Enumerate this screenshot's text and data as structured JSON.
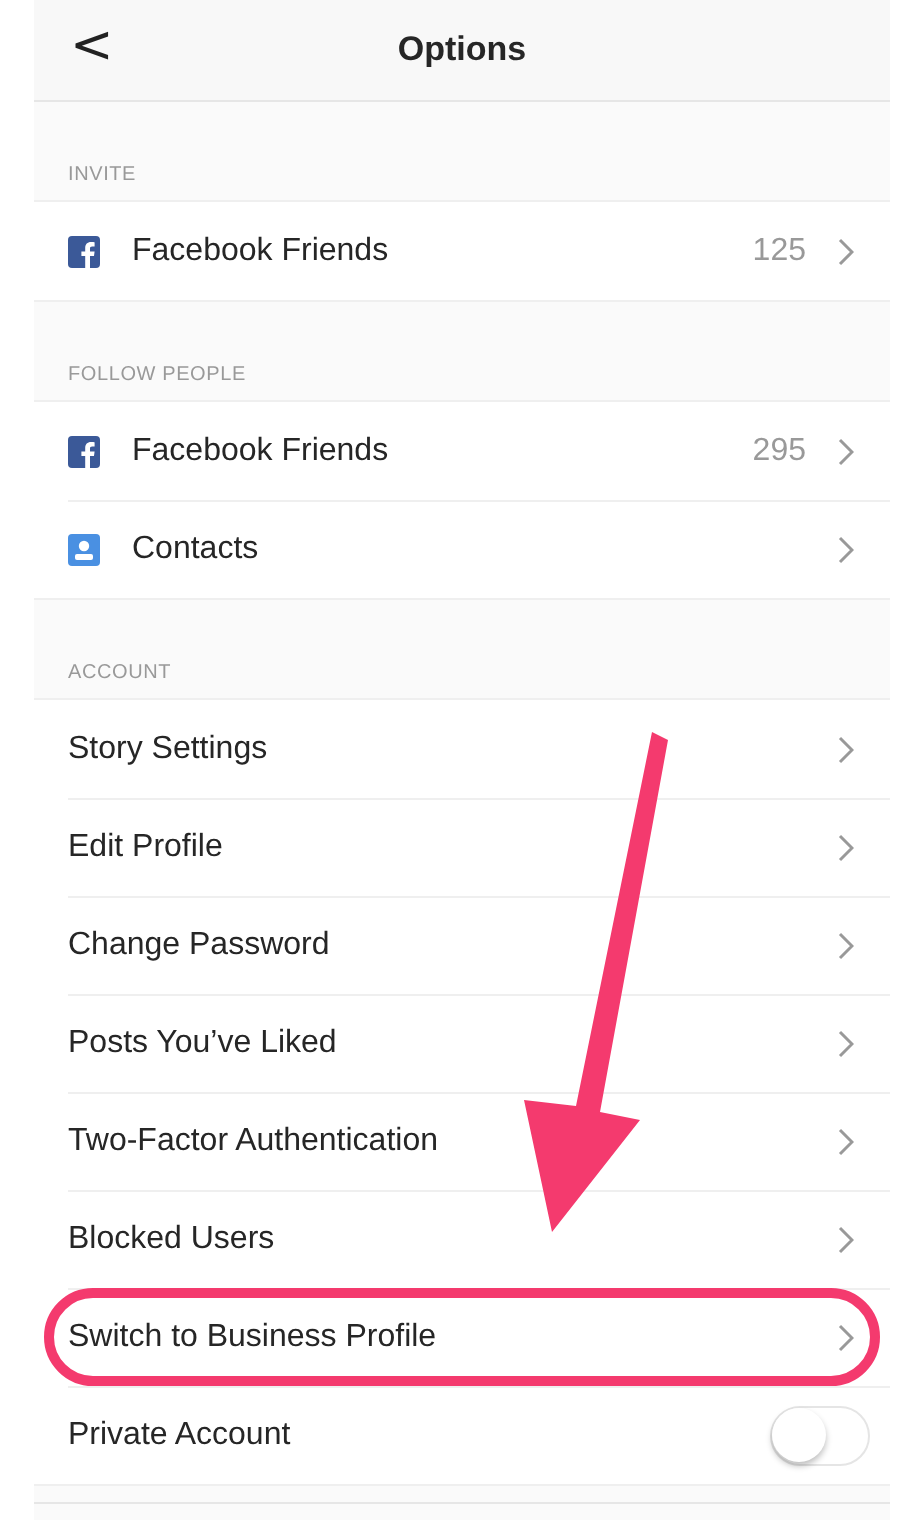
{
  "header": {
    "back": "<",
    "title": "Options"
  },
  "sections": [
    {
      "heading": "INVITE",
      "items": [
        {
          "kind": "facebook",
          "label": "Facebook Friends",
          "count": "125",
          "highlighted": false
        }
      ]
    },
    {
      "heading": "FOLLOW PEOPLE",
      "items": [
        {
          "kind": "facebook",
          "label": "Facebook Friends",
          "count": "295",
          "highlighted": false
        },
        {
          "kind": "contacts",
          "label": "Contacts",
          "highlighted": false
        }
      ]
    },
    {
      "heading": "ACCOUNT",
      "items": [
        {
          "kind": "link",
          "label": "Story Settings",
          "highlighted": false
        },
        {
          "kind": "link",
          "label": "Edit Profile",
          "highlighted": false
        },
        {
          "kind": "link",
          "label": "Change Password",
          "highlighted": false
        },
        {
          "kind": "link",
          "label": "Posts You’ve Liked",
          "highlighted": false
        },
        {
          "kind": "link",
          "label": "Two-Factor Authentication",
          "highlighted": false
        },
        {
          "kind": "link",
          "label": "Blocked Users",
          "highlighted": false
        },
        {
          "kind": "link",
          "label": "Switch to Business Profile",
          "highlighted": true
        },
        {
          "kind": "toggle",
          "label": "Private Account",
          "on": false,
          "highlighted": false
        }
      ]
    }
  ]
}
